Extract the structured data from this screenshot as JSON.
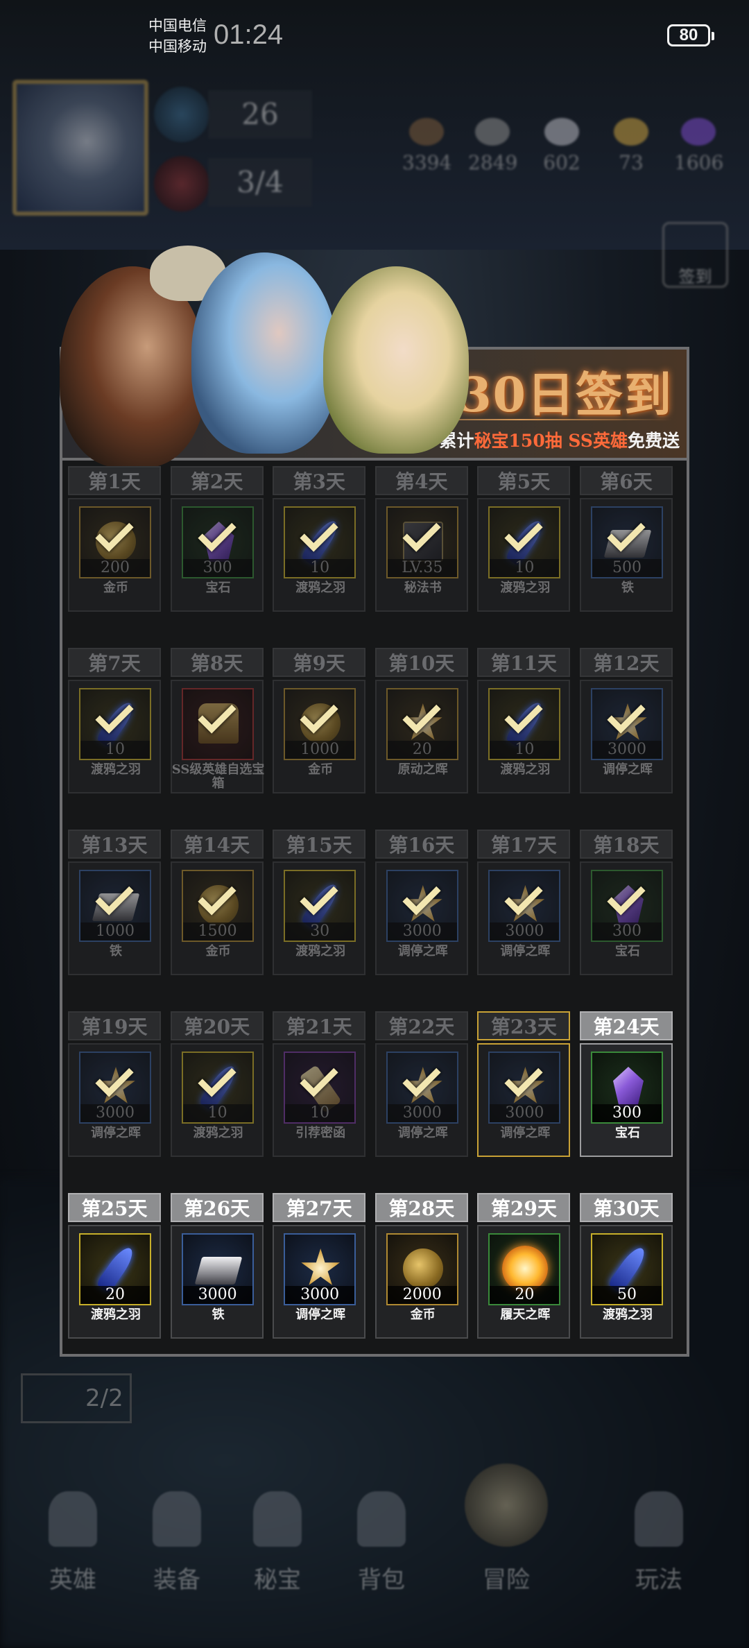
{
  "status_bar": {
    "carrier_1": "中国电信",
    "carrier_2": "中国移动",
    "time": "01:24",
    "battery": "80"
  },
  "hud": {
    "level": "26",
    "stamina": "3/4",
    "resources": [
      "3394",
      "2849",
      "602",
      "73",
      "1606"
    ],
    "sign_label": "签到",
    "side_badge": "2/2"
  },
  "bottom_nav": [
    {
      "label": "英雄"
    },
    {
      "label": "装备"
    },
    {
      "label": "秘宝"
    },
    {
      "label": "背包"
    },
    {
      "label": "冒险"
    },
    {
      "label": "玩法"
    }
  ],
  "signin": {
    "title": "30日签到",
    "subtitle_prefix": "累计",
    "subtitle_highlight": "秘宝150抽 SS英雄",
    "subtitle_suffix": "免费送",
    "days": [
      {
        "day": "第1天",
        "qty": "200",
        "name": "金币",
        "icon": "coin-icon",
        "frame": "gold",
        "state": "claimed"
      },
      {
        "day": "第2天",
        "qty": "300",
        "name": "宝石",
        "icon": "gem-icon",
        "frame": "green",
        "state": "claimed"
      },
      {
        "day": "第3天",
        "qty": "10",
        "name": "渡鸦之羽",
        "icon": "feather-icon",
        "frame": "yellow",
        "state": "claimed"
      },
      {
        "day": "第4天",
        "qty": "LV.35",
        "name": "秘法书",
        "icon": "book-icon",
        "frame": "gold",
        "state": "claimed"
      },
      {
        "day": "第5天",
        "qty": "10",
        "name": "渡鸦之羽",
        "icon": "feather-icon",
        "frame": "yellow",
        "state": "claimed"
      },
      {
        "day": "第6天",
        "qty": "500",
        "name": "铁",
        "icon": "iron-icon",
        "frame": "blue",
        "state": "claimed"
      },
      {
        "day": "第7天",
        "qty": "10",
        "name": "渡鸦之羽",
        "icon": "feather-icon",
        "frame": "yellow",
        "state": "claimed"
      },
      {
        "day": "第8天",
        "qty": "",
        "name": "SS级英雄自选宝箱",
        "icon": "chest-icon",
        "frame": "red",
        "state": "claimed"
      },
      {
        "day": "第9天",
        "qty": "1000",
        "name": "金币",
        "icon": "coin-icon",
        "frame": "gold",
        "state": "claimed"
      },
      {
        "day": "第10天",
        "qty": "20",
        "name": "原动之晖",
        "icon": "star-icon",
        "frame": "gold",
        "state": "claimed"
      },
      {
        "day": "第11天",
        "qty": "10",
        "name": "渡鸦之羽",
        "icon": "feather-icon",
        "frame": "yellow",
        "state": "claimed"
      },
      {
        "day": "第12天",
        "qty": "3000",
        "name": "调停之晖",
        "icon": "star-icon",
        "frame": "blue",
        "state": "claimed"
      },
      {
        "day": "第13天",
        "qty": "1000",
        "name": "铁",
        "icon": "iron-icon",
        "frame": "blue",
        "state": "claimed"
      },
      {
        "day": "第14天",
        "qty": "1500",
        "name": "金币",
        "icon": "coin-icon",
        "frame": "gold",
        "state": "claimed"
      },
      {
        "day": "第15天",
        "qty": "30",
        "name": "渡鸦之羽",
        "icon": "feather-icon",
        "frame": "yellow",
        "state": "claimed"
      },
      {
        "day": "第16天",
        "qty": "3000",
        "name": "调停之晖",
        "icon": "star-icon",
        "frame": "blue",
        "state": "claimed"
      },
      {
        "day": "第17天",
        "qty": "3000",
        "name": "调停之晖",
        "icon": "star-icon",
        "frame": "blue",
        "state": "claimed"
      },
      {
        "day": "第18天",
        "qty": "300",
        "name": "宝石",
        "icon": "gem-icon",
        "frame": "green",
        "state": "claimed"
      },
      {
        "day": "第19天",
        "qty": "3000",
        "name": "调停之晖",
        "icon": "star-icon",
        "frame": "blue",
        "state": "claimed"
      },
      {
        "day": "第20天",
        "qty": "10",
        "name": "渡鸦之羽",
        "icon": "feather-icon",
        "frame": "yellow",
        "state": "claimed"
      },
      {
        "day": "第21天",
        "qty": "10",
        "name": "引荐密函",
        "icon": "scroll-icon",
        "frame": "purple",
        "state": "claimed"
      },
      {
        "day": "第22天",
        "qty": "3000",
        "name": "调停之晖",
        "icon": "star-icon",
        "frame": "blue",
        "state": "claimed"
      },
      {
        "day": "第23天",
        "qty": "3000",
        "name": "调停之晖",
        "icon": "star-icon",
        "frame": "blue",
        "state": "today"
      },
      {
        "day": "第24天",
        "qty": "300",
        "name": "宝石",
        "icon": "gem-icon",
        "frame": "green",
        "state": "claimable"
      },
      {
        "day": "第25天",
        "qty": "20",
        "name": "渡鸦之羽",
        "icon": "feather-icon",
        "frame": "yellow",
        "state": "upcoming"
      },
      {
        "day": "第26天",
        "qty": "3000",
        "name": "铁",
        "icon": "iron-icon",
        "frame": "blue",
        "state": "upcoming"
      },
      {
        "day": "第27天",
        "qty": "3000",
        "name": "调停之晖",
        "icon": "star-icon",
        "frame": "blue",
        "state": "upcoming"
      },
      {
        "day": "第28天",
        "qty": "2000",
        "name": "金币",
        "icon": "coin-icon",
        "frame": "gold",
        "state": "upcoming"
      },
      {
        "day": "第29天",
        "qty": "20",
        "name": "履天之晖",
        "icon": "sun-icon",
        "frame": "green",
        "state": "upcoming"
      },
      {
        "day": "第30天",
        "qty": "50",
        "name": "渡鸦之羽",
        "icon": "feather-icon",
        "frame": "yellow",
        "state": "upcoming"
      }
    ]
  }
}
